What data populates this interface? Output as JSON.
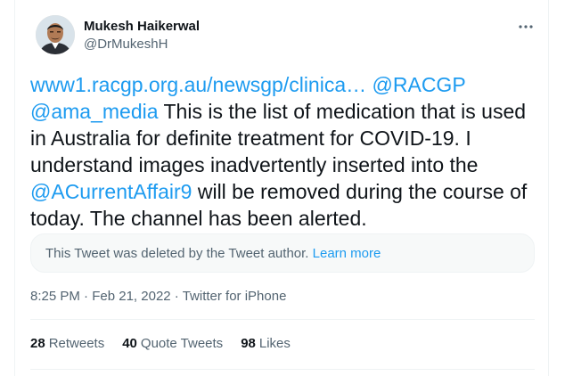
{
  "author": {
    "display_name": "Mukesh Haikerwal",
    "handle": "@DrMukeshH"
  },
  "tweet": {
    "link_url": "www1.racgp.org.au/newsgp/clinica…",
    "mention_1": "@RACGP",
    "mention_2": "@ama_media",
    "text_1": " This is the list of medication that is used in Australia for definite treatment for COVID-19. I understand images inadvertently inserted into the ",
    "mention_3": "@ACurrentAffair9",
    "text_2": " will be removed during the course of today. The channel has been alerted."
  },
  "deleted_notice": {
    "text": "This Tweet was deleted by the Tweet author.",
    "learn_more": "Learn more"
  },
  "meta": {
    "time": "8:25 PM",
    "separator": "·",
    "date": "Feb 21, 2022",
    "source": "Twitter for iPhone"
  },
  "stats": {
    "retweets_count": "28",
    "retweets_label": "Retweets",
    "quotes_count": "40",
    "quotes_label": "Quote Tweets",
    "likes_count": "98",
    "likes_label": "Likes"
  },
  "colors": {
    "link": "#1d9bf0",
    "text": "#0f1419",
    "secondary": "#536471"
  },
  "icons": {
    "more": "more-dots-icon"
  }
}
